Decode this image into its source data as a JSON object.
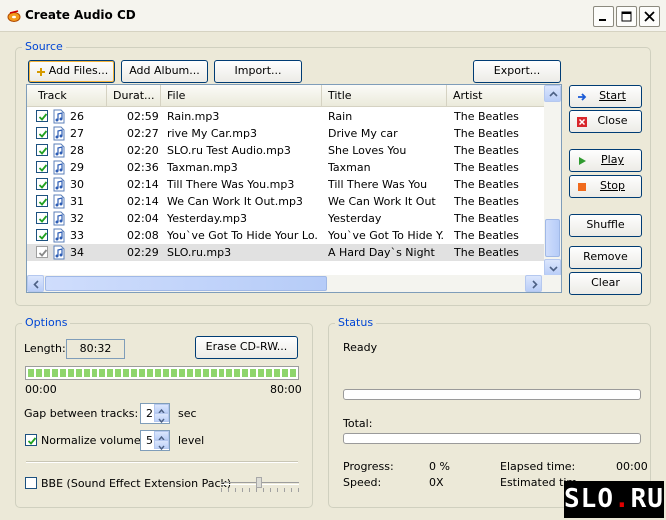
{
  "window": {
    "title": "Create Audio CD"
  },
  "source": {
    "legend": "Source",
    "buttons": {
      "add_files": "Add Files...",
      "add_album": "Add Album...",
      "import": "Import...",
      "export": "Export..."
    },
    "columns": [
      "Track",
      "Durat...",
      "File",
      "Title",
      "Artist"
    ],
    "rows": [
      {
        "checked": true,
        "track": "26",
        "duration": "02:59",
        "file": "Rain.mp3",
        "title": "Rain",
        "artist": "The Beatles",
        "selected": false
      },
      {
        "checked": true,
        "track": "27",
        "duration": "02:27",
        "file": "rive My Car.mp3",
        "title": "Drive My car",
        "artist": "The Beatles",
        "selected": false
      },
      {
        "checked": true,
        "track": "28",
        "duration": "02:20",
        "file": "SLO.ru Test Audio.mp3",
        "title": "She Loves You",
        "artist": "The Beatles",
        "selected": false
      },
      {
        "checked": true,
        "track": "29",
        "duration": "02:36",
        "file": "Taxman.mp3",
        "title": "Taxman",
        "artist": "The Beatles",
        "selected": false
      },
      {
        "checked": true,
        "track": "30",
        "duration": "02:14",
        "file": "Till There Was You.mp3",
        "title": "Till There Was You",
        "artist": "The Beatles",
        "selected": false
      },
      {
        "checked": true,
        "track": "31",
        "duration": "02:14",
        "file": "We Can Work It Out.mp3",
        "title": "We Can Work It Out",
        "artist": "The Beatles",
        "selected": false
      },
      {
        "checked": true,
        "track": "32",
        "duration": "02:04",
        "file": "Yesterday.mp3",
        "title": "Yesterday",
        "artist": "The Beatles",
        "selected": false
      },
      {
        "checked": true,
        "track": "33",
        "duration": "02:08",
        "file": "You`ve Got To Hide Your Lo...",
        "title": "You`ve Got To Hide Y...",
        "artist": "The Beatles",
        "selected": false
      },
      {
        "checked": true,
        "track": "34",
        "duration": "02:29",
        "file": "SLO.ru.mp3",
        "title": "A Hard Day`s Night",
        "artist": "The Beatles",
        "selected": true
      }
    ]
  },
  "side_buttons": {
    "start": "Start",
    "close": "Close",
    "play": "Play",
    "stop": "Stop",
    "shuffle": "Shuffle",
    "remove": "Remove",
    "clear": "Clear"
  },
  "options": {
    "legend": "Options",
    "length_label": "Length:",
    "length_value": "80:32",
    "erase_button": "Erase CD-RW...",
    "meter_fill_fraction": 1.0,
    "meter_start": "00:00",
    "meter_end": "80:00",
    "gap_label": "Gap between tracks:",
    "gap_value": "2",
    "gap_unit": "sec",
    "normalize_label": "Normalize volume:",
    "normalize_checked": true,
    "normalize_value": "5",
    "normalize_unit": "level",
    "bbe_label": "BBE (Sound Effect Extension Pack)",
    "bbe_checked": false
  },
  "status": {
    "legend": "Status",
    "state": "Ready",
    "track_progress_fraction": 0,
    "total_label": "Total:",
    "total_progress_fraction": 0,
    "progress_label": "Progress:",
    "progress_value": "0 %",
    "speed_label": "Speed:",
    "speed_value": "0X",
    "elapsed_label": "Elapsed time:",
    "elapsed_value": "00:00",
    "estimated_label": "Estimated tim"
  },
  "watermark": {
    "left": "SLO",
    "dot": ".",
    "right": "RU"
  },
  "colors": {
    "accent": "#0046d5",
    "meter_green": "#8ed56c",
    "selection": "#e1e1e1"
  }
}
